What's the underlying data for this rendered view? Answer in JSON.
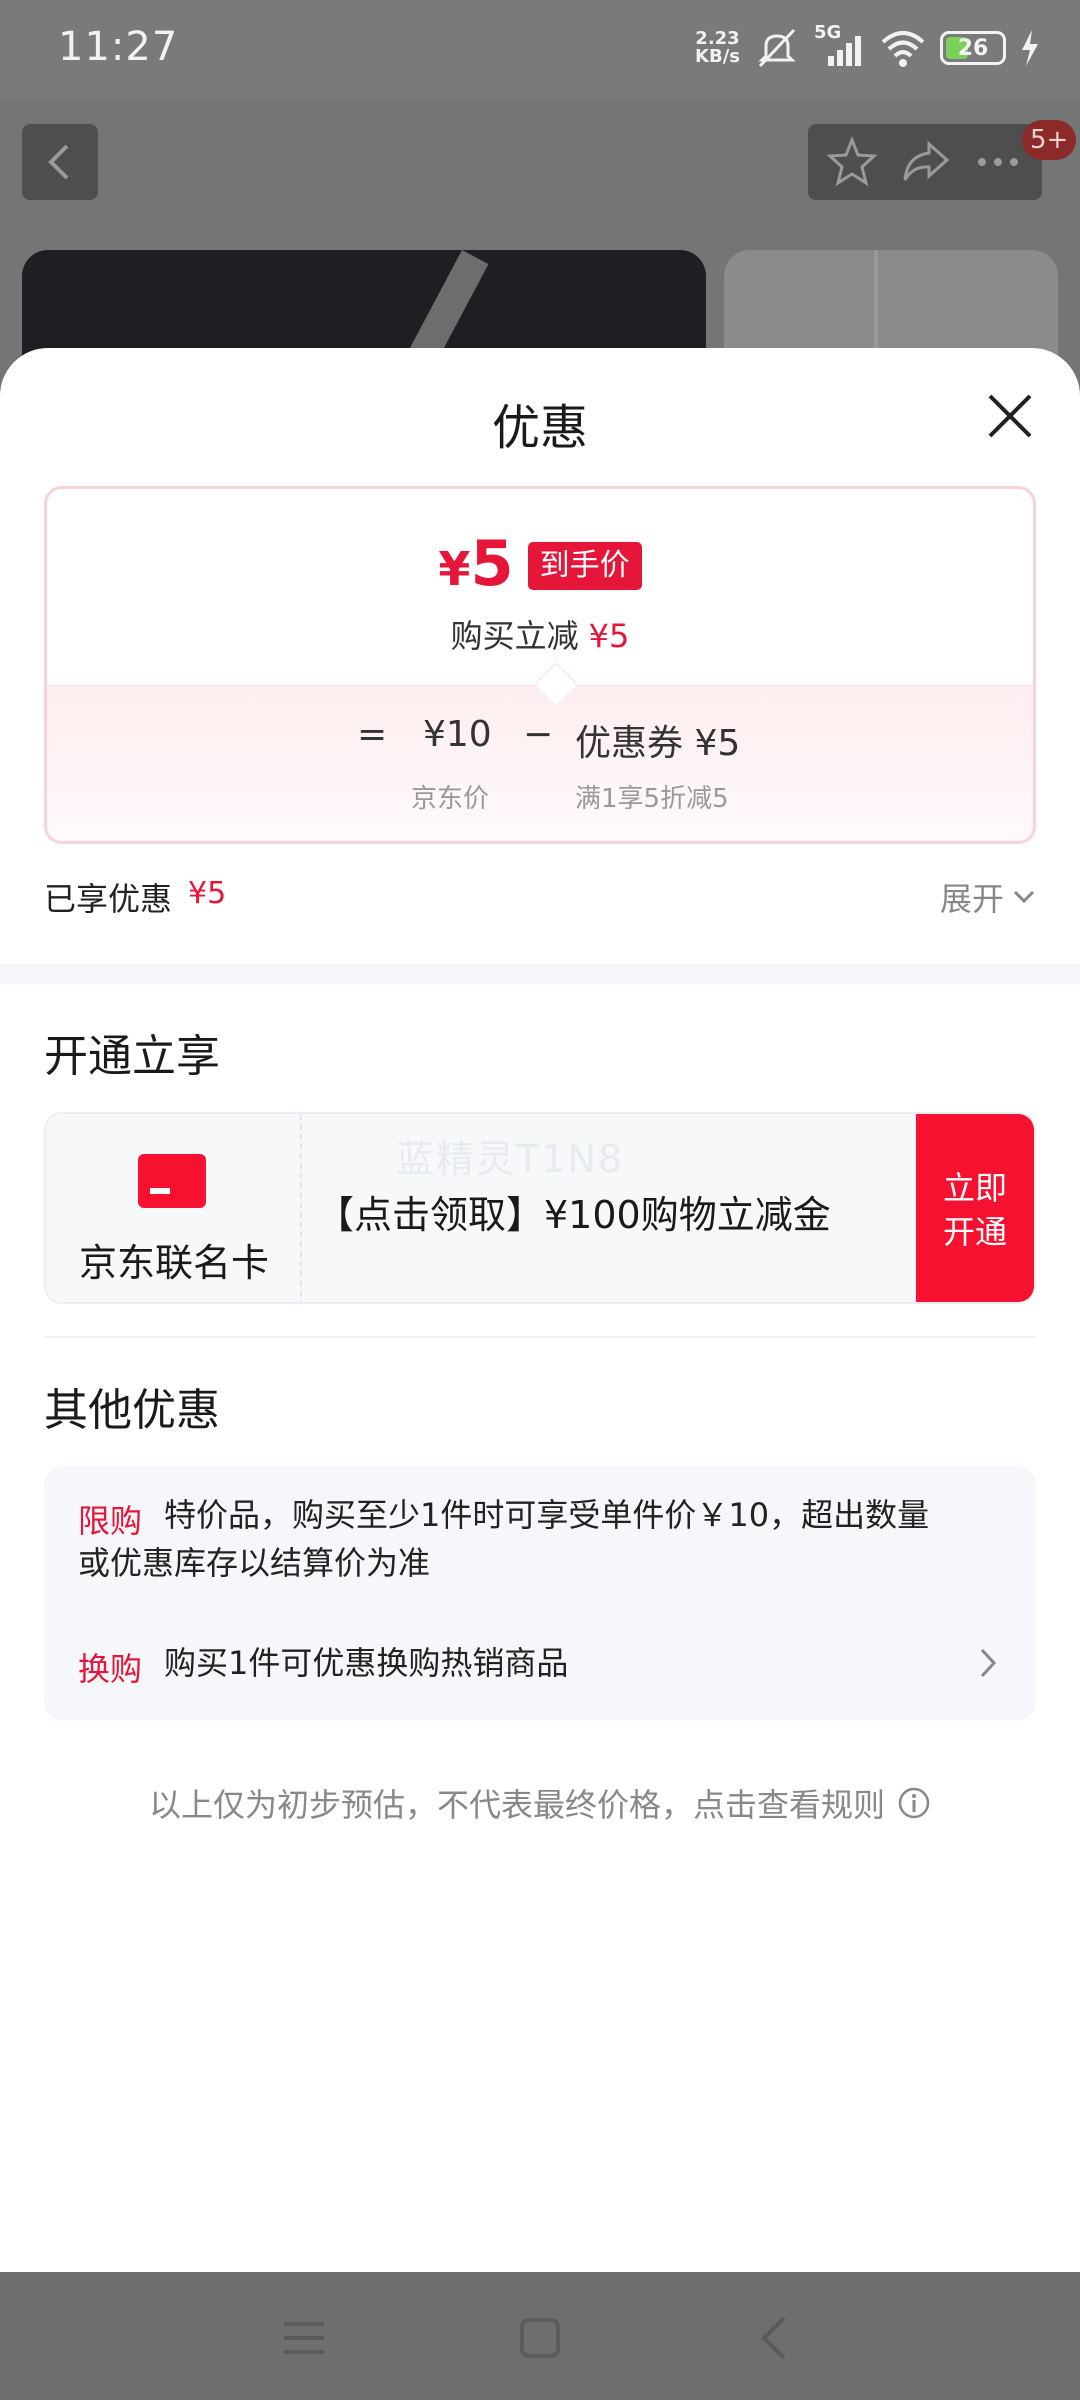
{
  "status_bar": {
    "time": "11:27",
    "net_speed_value": "2.23",
    "net_speed_unit": "KB/s",
    "signal": "5G",
    "battery": "26"
  },
  "background": {
    "badge": "5+"
  },
  "sheet": {
    "title": "优惠",
    "price_card": {
      "currency": "¥",
      "final_price": "5",
      "tag": "到手价",
      "instant_discount_label": "购买立减",
      "instant_discount_value": "¥5",
      "equals": "=",
      "jd_price_value": "¥10",
      "minus": "−",
      "coupon_label": "优惠券",
      "coupon_value": "¥5",
      "jd_price_label": "京东价",
      "coupon_rule": "满1享5折减5"
    },
    "enjoyed": {
      "label": "已享优惠",
      "amount": "¥5",
      "expand_label": "展开"
    },
    "open_section": {
      "title": "开通立享",
      "card_name": "京东联名卡",
      "watermark": "蓝精灵T1N8",
      "offer_text": "【点击领取】¥100购物立减金",
      "button_line1": "立即",
      "button_line2": "开通"
    },
    "other_section": {
      "title": "其他优惠",
      "items": [
        {
          "tag": "限购",
          "text_line1": "特价品，购买至少1件时可享受单件价￥10，超出数量",
          "text_line2": "或优惠库存以结算价为准"
        },
        {
          "tag": "换购",
          "text": "购买1件可优惠换购热销商品"
        }
      ]
    },
    "disclaimer": "以上仅为初步预估，不代表最终价格，点击查看规则"
  },
  "icons": {
    "back": "chevron-left-icon",
    "favorite": "star-icon",
    "share": "share-icon",
    "more": "more-icon",
    "close": "close-icon",
    "card": "credit-card-icon",
    "info": "info-icon"
  },
  "colors": {
    "accent_red": "#e6163a",
    "button_red": "#f5112f",
    "card_border": "#f7d3d8"
  }
}
